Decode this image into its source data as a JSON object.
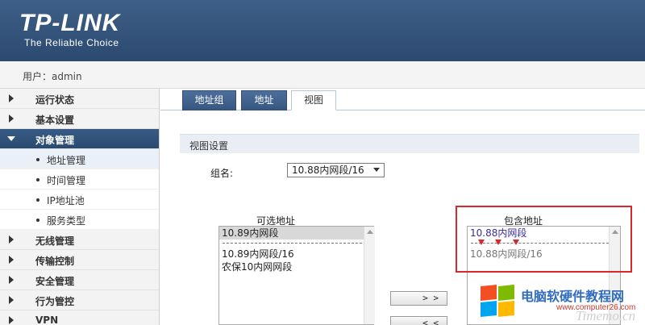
{
  "header": {
    "brand": "TP-LINK",
    "tagline": "The Reliable Choice"
  },
  "userbar": {
    "user_text": "用户：admin"
  },
  "sidebar": {
    "items": [
      {
        "label": "运行状态",
        "state": "collapsed"
      },
      {
        "label": "基本设置",
        "state": "collapsed"
      },
      {
        "label": "对象管理",
        "state": "expanded"
      },
      {
        "label": "无线管理",
        "state": "collapsed"
      },
      {
        "label": "传输控制",
        "state": "collapsed"
      },
      {
        "label": "安全管理",
        "state": "collapsed"
      },
      {
        "label": "行为管控",
        "state": "collapsed"
      },
      {
        "label": "VPN",
        "state": "collapsed"
      }
    ],
    "sub_items": [
      "地址管理",
      "时间管理",
      "IP地址池",
      "服务类型"
    ],
    "active_sub": "地址管理"
  },
  "tabs": [
    {
      "label": "地址组",
      "selected": false
    },
    {
      "label": "地址",
      "selected": false
    },
    {
      "label": "视图",
      "selected": true
    }
  ],
  "section": {
    "title": "视图设置"
  },
  "form": {
    "group_label": "组名:",
    "group_value": "10.88内网段/16"
  },
  "available": {
    "title": "可选地址",
    "selected_option": "10.89内网段",
    "options": [
      "10.89内网段/16",
      "农保10内网网段"
    ]
  },
  "included": {
    "title": "包含地址",
    "selected_option": "10.88内网段",
    "options": [
      "10.88内网段/16"
    ]
  },
  "buttons": {
    "add": "> >",
    "remove": "< <"
  },
  "watermark": {
    "cn": "电脑软硬件教程网",
    "url": "www.computer26.com",
    "big": "Timemo.cn"
  },
  "colors": {
    "header": "#2c4a70",
    "tab": "#4d6f99",
    "highlight": "#d9272e",
    "included_text": "#3a2a9a"
  }
}
